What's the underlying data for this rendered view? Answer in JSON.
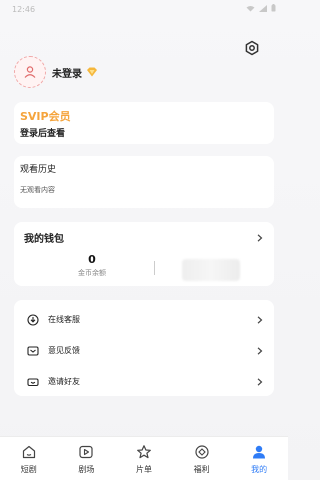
{
  "status_bar": {
    "time": "12:46"
  },
  "profile": {
    "login_label": "未登录"
  },
  "svip": {
    "title": "SVIP会员",
    "subtitle": "登录后查看"
  },
  "history": {
    "title": "观看历史",
    "empty_text": "无观看内容"
  },
  "wallet": {
    "title": "我的钱包",
    "coin_value": "0",
    "coin_label": "金币余额"
  },
  "menu": {
    "items": [
      {
        "label": "在线客服",
        "icon": "download-circle-icon"
      },
      {
        "label": "意见反馈",
        "icon": "feedback-icon"
      },
      {
        "label": "邀请好友",
        "icon": "invite-icon"
      }
    ]
  },
  "tabbar": {
    "items": [
      {
        "label": "短剧",
        "icon": "home-icon"
      },
      {
        "label": "剧场",
        "icon": "play-icon"
      },
      {
        "label": "片单",
        "icon": "star-icon"
      },
      {
        "label": "福利",
        "icon": "gift-diamond-icon"
      },
      {
        "label": "我的",
        "icon": "user-icon",
        "active": true
      }
    ]
  },
  "colors": {
    "accent": "#2f7cf6",
    "svip": "#f5a43c",
    "vip_badge": "#f5b73c"
  }
}
